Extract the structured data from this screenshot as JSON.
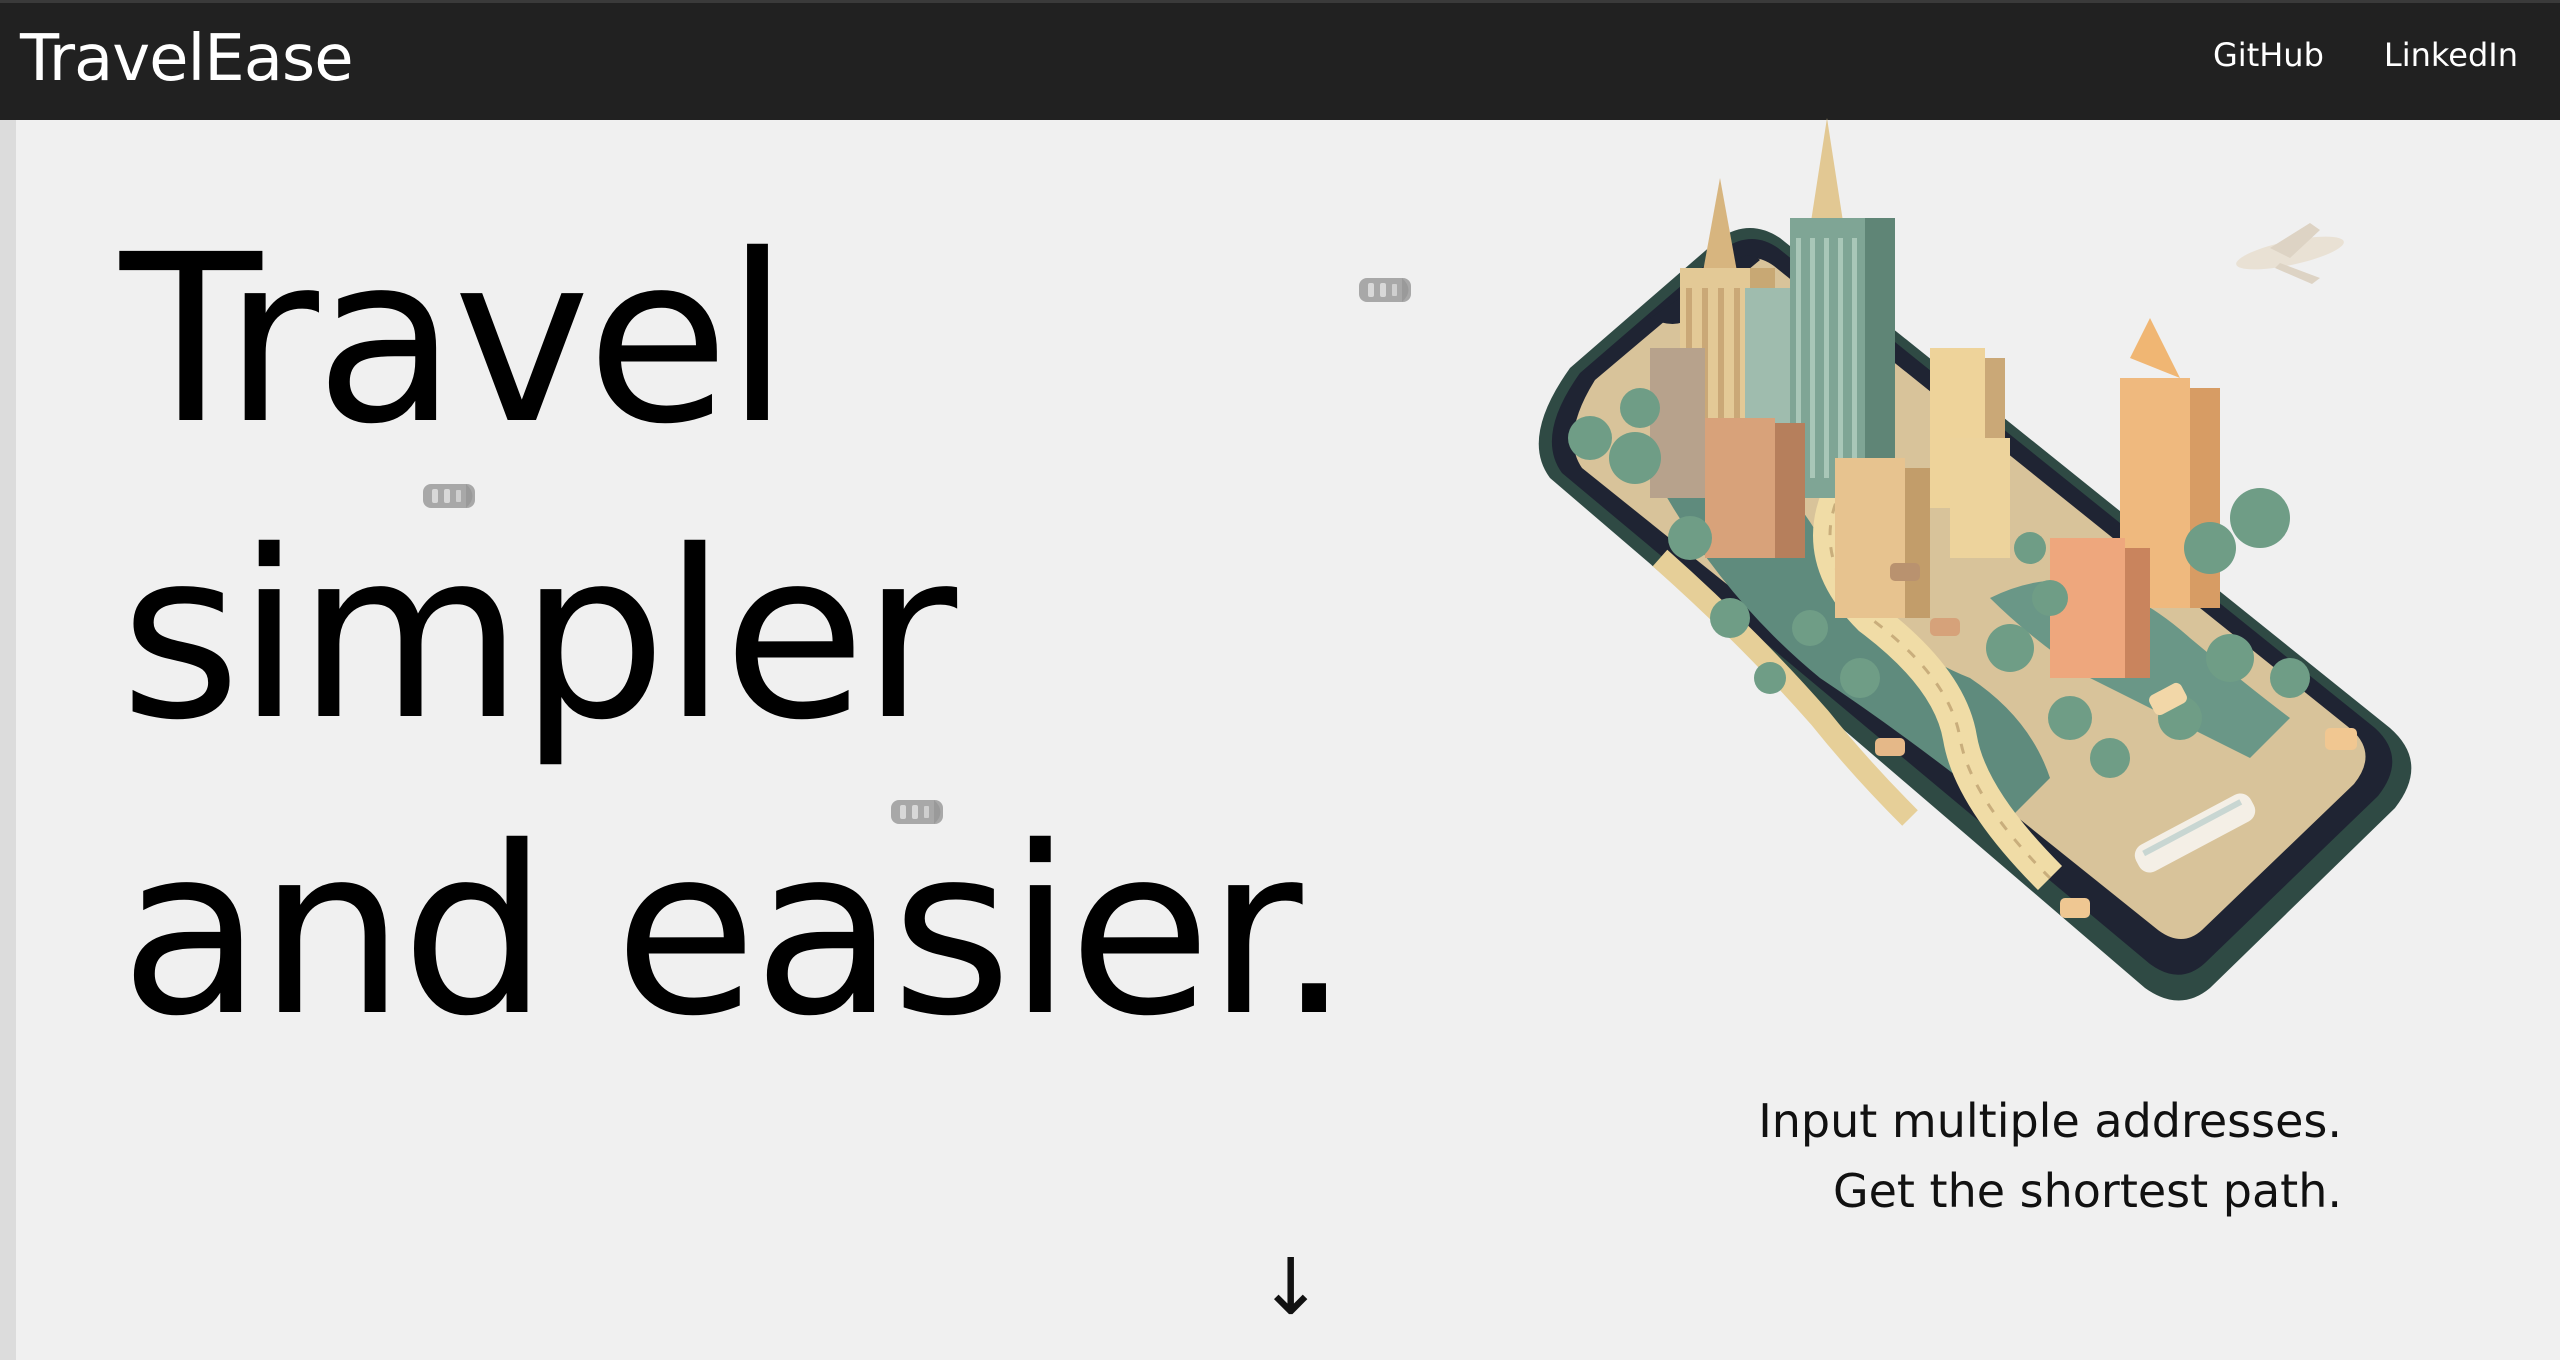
{
  "app": {
    "brand": "TravelEase"
  },
  "nav": {
    "links": [
      {
        "label": "GitHub"
      },
      {
        "label": "LinkedIn"
      }
    ]
  },
  "hero": {
    "title_lines": [
      "Travel",
      "simpler",
      "and easier."
    ],
    "tagline_lines": [
      "Input multiple addresses.",
      "Get the shortest path."
    ],
    "scroll_arrow": "↓"
  },
  "colors": {
    "navbar_bg": "#212121",
    "page_bg": "#f0f0f0",
    "text": "#000000"
  },
  "icons": {
    "car": "car-icon",
    "illustration": "phone-city-illustration",
    "arrow": "arrow-down-icon"
  }
}
